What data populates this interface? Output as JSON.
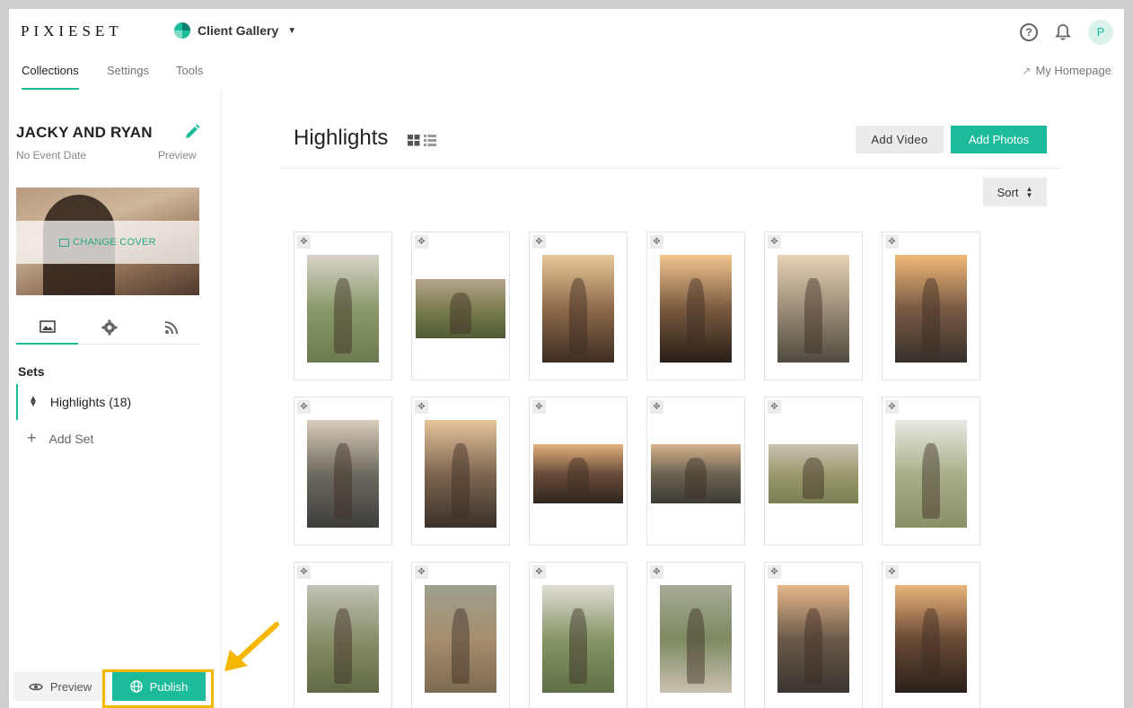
{
  "header": {
    "logo": "PIXIESET",
    "app_switcher": "Client Gallery",
    "help": "?",
    "avatar": "P"
  },
  "nav": {
    "tabs": [
      "Collections",
      "Settings",
      "Tools"
    ],
    "active_tab": "Collections",
    "homepage_link": "My Homepage"
  },
  "collection": {
    "title": "JACKY AND RYAN",
    "event_date": "No Event Date",
    "preview_link": "Preview",
    "change_cover": "CHANGE COVER"
  },
  "sets": {
    "label": "Sets",
    "items": [
      {
        "name": "Highlights (18)"
      }
    ],
    "add_label": "Add Set"
  },
  "footer_buttons": {
    "preview": "Preview",
    "publish": "Publish"
  },
  "main": {
    "title": "Highlights",
    "add_video": "Add Video",
    "add_photos": "Add Photos",
    "sort": "Sort"
  },
  "photos": [
    {
      "orientation": "portrait",
      "tones": [
        "#d8d3c9",
        "#8a9a6a",
        "#6c7a4f"
      ]
    },
    {
      "orientation": "landscape",
      "tones": [
        "#b7a58e",
        "#7c7e4e",
        "#4f5a35"
      ]
    },
    {
      "orientation": "portrait",
      "tones": [
        "#e9c99a",
        "#8e6a4a",
        "#3d2e23"
      ]
    },
    {
      "orientation": "portrait",
      "tones": [
        "#f1c690",
        "#7a5a40",
        "#2a1f18"
      ]
    },
    {
      "orientation": "portrait",
      "tones": [
        "#e7d3b6",
        "#9b8d78",
        "#4e4a40"
      ]
    },
    {
      "orientation": "portrait",
      "tones": [
        "#f0b976",
        "#7a5a45",
        "#34302a"
      ]
    },
    {
      "orientation": "portrait",
      "tones": [
        "#d9cdbb",
        "#6e6a60",
        "#3e3d3a"
      ]
    },
    {
      "orientation": "portrait",
      "tones": [
        "#e6c49c",
        "#7e6650",
        "#3a312a"
      ]
    },
    {
      "orientation": "landscape",
      "tones": [
        "#e4b27e",
        "#6a4c3a",
        "#2f2520"
      ]
    },
    {
      "orientation": "landscape",
      "tones": [
        "#d8b48e",
        "#6a6452",
        "#3d3b35"
      ]
    },
    {
      "orientation": "landscape",
      "tones": [
        "#c9c3b3",
        "#9b9a6e",
        "#7a7d52"
      ]
    },
    {
      "orientation": "portrait",
      "tones": [
        "#ebe9e4",
        "#a8b08a",
        "#8a8f66"
      ]
    },
    {
      "orientation": "portrait",
      "tones": [
        "#c2c3b6",
        "#8a8e6a",
        "#5f6a45"
      ]
    },
    {
      "orientation": "portrait",
      "tones": [
        "#9fa08e",
        "#a68e6e",
        "#7d6a50"
      ]
    },
    {
      "orientation": "portrait",
      "tones": [
        "#e0ddd5",
        "#879667",
        "#5d6f45"
      ]
    },
    {
      "orientation": "portrait",
      "tones": [
        "#a7ab97",
        "#7d8a62",
        "#c9c0b0"
      ]
    },
    {
      "orientation": "portrait",
      "tones": [
        "#e8b88a",
        "#6a5a4a",
        "#3a3532"
      ]
    },
    {
      "orientation": "portrait",
      "tones": [
        "#eab47a",
        "#6a4a36",
        "#2a1f1a"
      ]
    }
  ],
  "colors": {
    "accent": "#1cbb9b",
    "highlight": "#f5b700"
  }
}
